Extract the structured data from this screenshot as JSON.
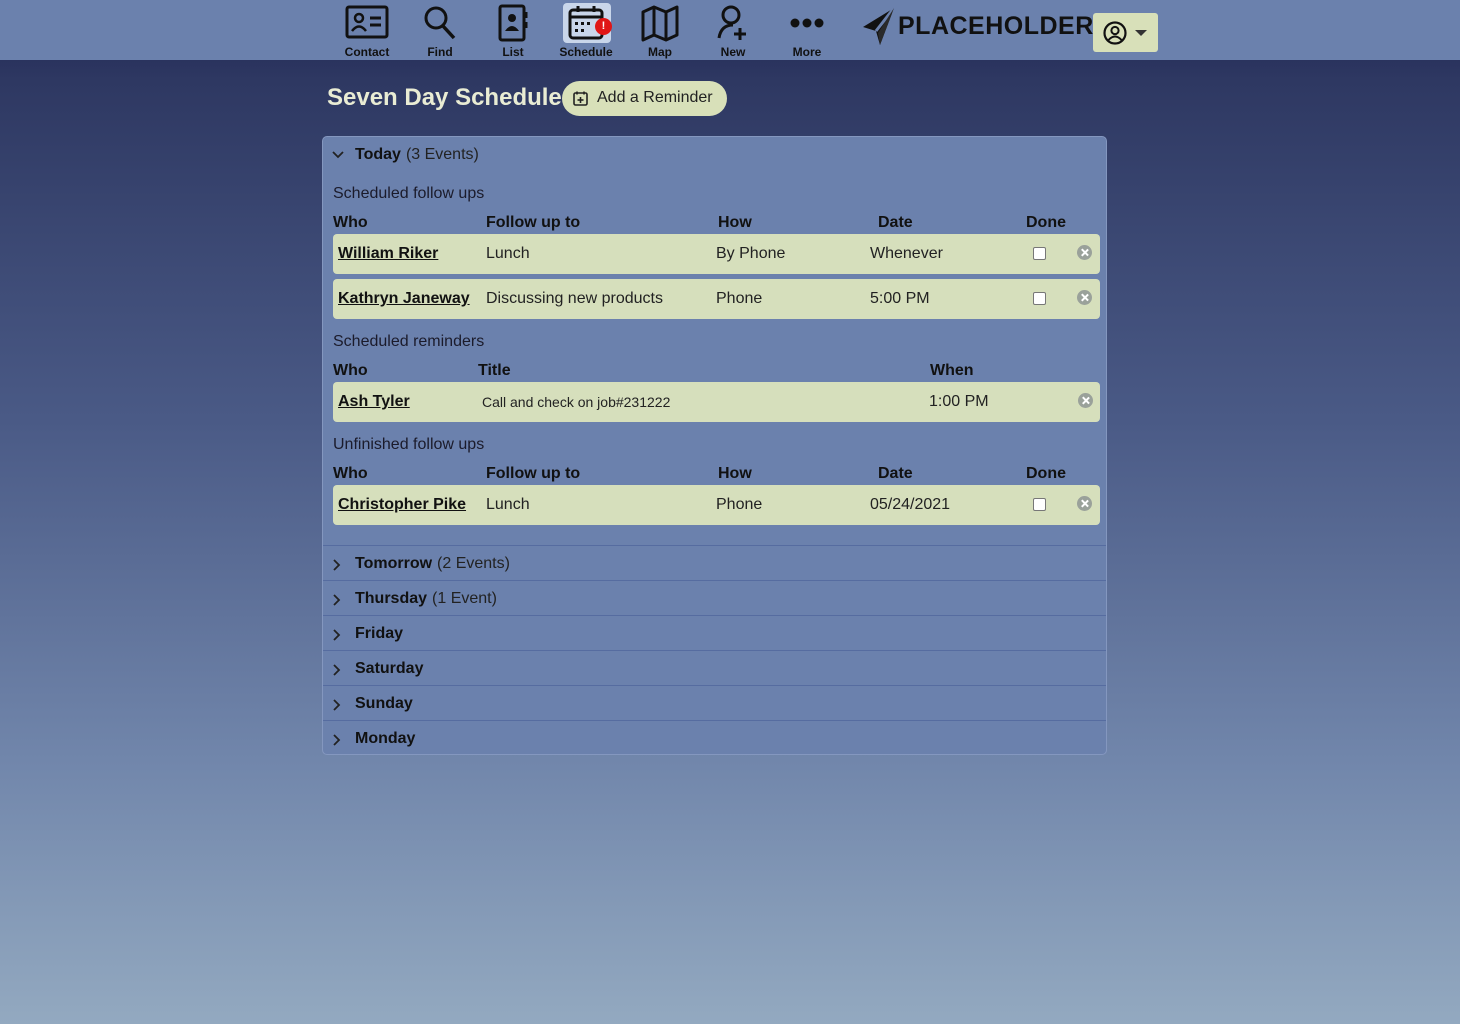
{
  "nav": {
    "items": [
      {
        "label": "Contact",
        "icon": "contact-card-icon"
      },
      {
        "label": "Find",
        "icon": "search-icon"
      },
      {
        "label": "List",
        "icon": "address-book-icon"
      },
      {
        "label": "Schedule",
        "icon": "calendar-icon",
        "active": true,
        "badge": "!"
      },
      {
        "label": "Map",
        "icon": "map-icon"
      },
      {
        "label": "New",
        "icon": "add-user-icon"
      },
      {
        "label": "More",
        "icon": "more-dots-icon"
      }
    ],
    "logo_text": "PLACEHOLDER",
    "user_menu_icon": "user-circle-icon"
  },
  "page": {
    "title": "Seven Day Schedule",
    "add_reminder_label": "Add a Reminder"
  },
  "today": {
    "label": "Today",
    "count": "(3 Events)",
    "followups": {
      "title": "Scheduled follow ups",
      "headers": {
        "who": "Who",
        "follow": "Follow up to",
        "how": "How",
        "date": "Date",
        "done": "Done"
      },
      "rows": [
        {
          "who": "William Riker",
          "follow": "Lunch",
          "how": "By Phone",
          "date": "Whenever",
          "done": false
        },
        {
          "who": "Kathryn Janeway",
          "follow": "Discussing new products",
          "how": "Phone",
          "date": "5:00 PM",
          "done": false
        }
      ]
    },
    "reminders": {
      "title": "Scheduled reminders",
      "headers": {
        "who": "Who",
        "title": "Title",
        "when": "When"
      },
      "rows": [
        {
          "who": "Ash Tyler",
          "title": "Call and check on job#231222",
          "when": "1:00 PM"
        }
      ]
    },
    "unfinished": {
      "title": "Unfinished follow ups",
      "headers": {
        "who": "Who",
        "follow": "Follow up to",
        "how": "How",
        "date": "Date",
        "done": "Done"
      },
      "rows": [
        {
          "who": "Christopher Pike",
          "follow": "Lunch",
          "how": "Phone",
          "date": "05/24/2021",
          "done": false
        }
      ]
    }
  },
  "days": [
    {
      "label": "Tomorrow",
      "count": "(2 Events)"
    },
    {
      "label": "Thursday",
      "count": "(1 Event)"
    },
    {
      "label": "Friday",
      "count": ""
    },
    {
      "label": "Saturday",
      "count": ""
    },
    {
      "label": "Sunday",
      "count": ""
    },
    {
      "label": "Monday",
      "count": ""
    }
  ],
  "colors": {
    "topbar": "#6b81ad",
    "row_bg": "#d6dfbc",
    "badge": "#e01616",
    "title": "#e9ecd4"
  }
}
